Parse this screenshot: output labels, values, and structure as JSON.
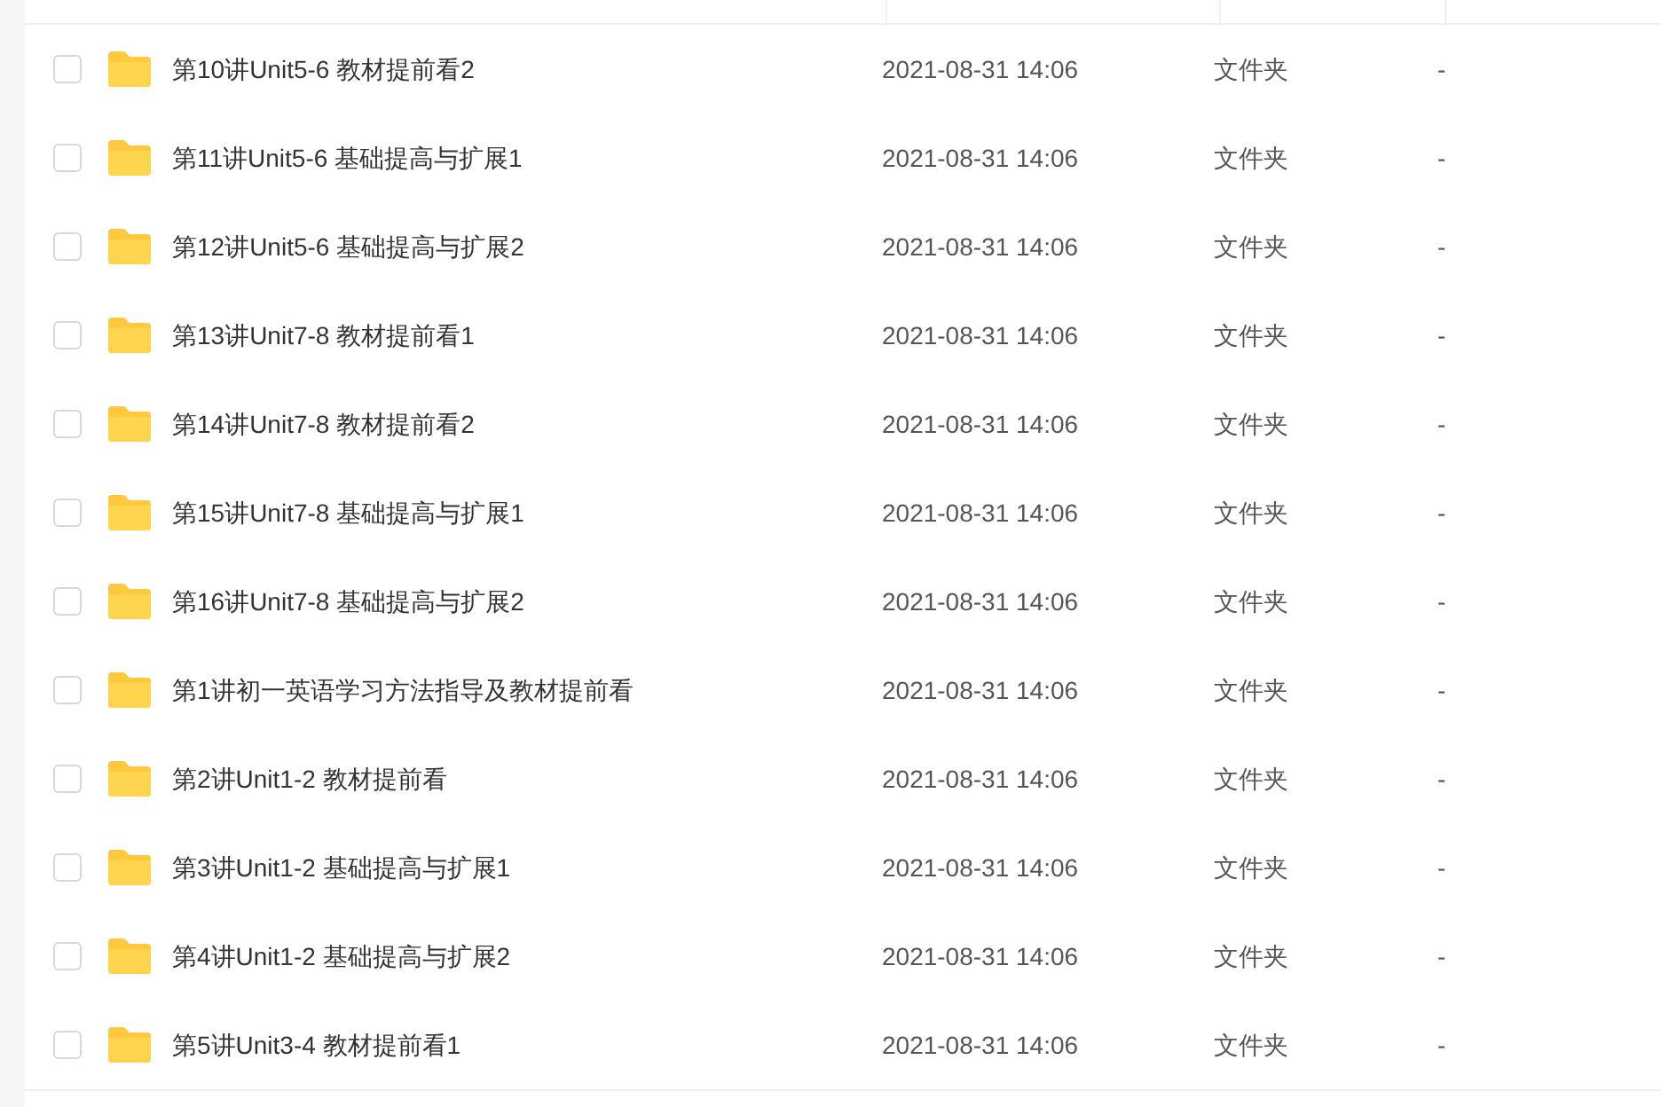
{
  "files": [
    {
      "name": "第10讲Unit5-6 教材提前看2",
      "modified": "2021-08-31 14:06",
      "type": "文件夹",
      "size": "-",
      "checked": false
    },
    {
      "name": "第11讲Unit5-6 基础提高与扩展1",
      "modified": "2021-08-31 14:06",
      "type": "文件夹",
      "size": "-",
      "checked": false
    },
    {
      "name": "第12讲Unit5-6 基础提高与扩展2",
      "modified": "2021-08-31 14:06",
      "type": "文件夹",
      "size": "-",
      "checked": false
    },
    {
      "name": "第13讲Unit7-8 教材提前看1",
      "modified": "2021-08-31 14:06",
      "type": "文件夹",
      "size": "-",
      "checked": false
    },
    {
      "name": "第14讲Unit7-8 教材提前看2",
      "modified": "2021-08-31 14:06",
      "type": "文件夹",
      "size": "-",
      "checked": false
    },
    {
      "name": "第15讲Unit7-8 基础提高与扩展1",
      "modified": "2021-08-31 14:06",
      "type": "文件夹",
      "size": "-",
      "checked": false
    },
    {
      "name": "第16讲Unit7-8 基础提高与扩展2",
      "modified": "2021-08-31 14:06",
      "type": "文件夹",
      "size": "-",
      "checked": false
    },
    {
      "name": "第1讲初一英语学习方法指导及教材提前看",
      "modified": "2021-08-31 14:06",
      "type": "文件夹",
      "size": "-",
      "checked": false
    },
    {
      "name": "第2讲Unit1-2 教材提前看",
      "modified": "2021-08-31 14:06",
      "type": "文件夹",
      "size": "-",
      "checked": false
    },
    {
      "name": "第3讲Unit1-2 基础提高与扩展1",
      "modified": "2021-08-31 14:06",
      "type": "文件夹",
      "size": "-",
      "checked": false
    },
    {
      "name": "第4讲Unit1-2 基础提高与扩展2",
      "modified": "2021-08-31 14:06",
      "type": "文件夹",
      "size": "-",
      "checked": false
    },
    {
      "name": "第5讲Unit3-4 教材提前看1",
      "modified": "2021-08-31 14:06",
      "type": "文件夹",
      "size": "-",
      "checked": false
    }
  ]
}
